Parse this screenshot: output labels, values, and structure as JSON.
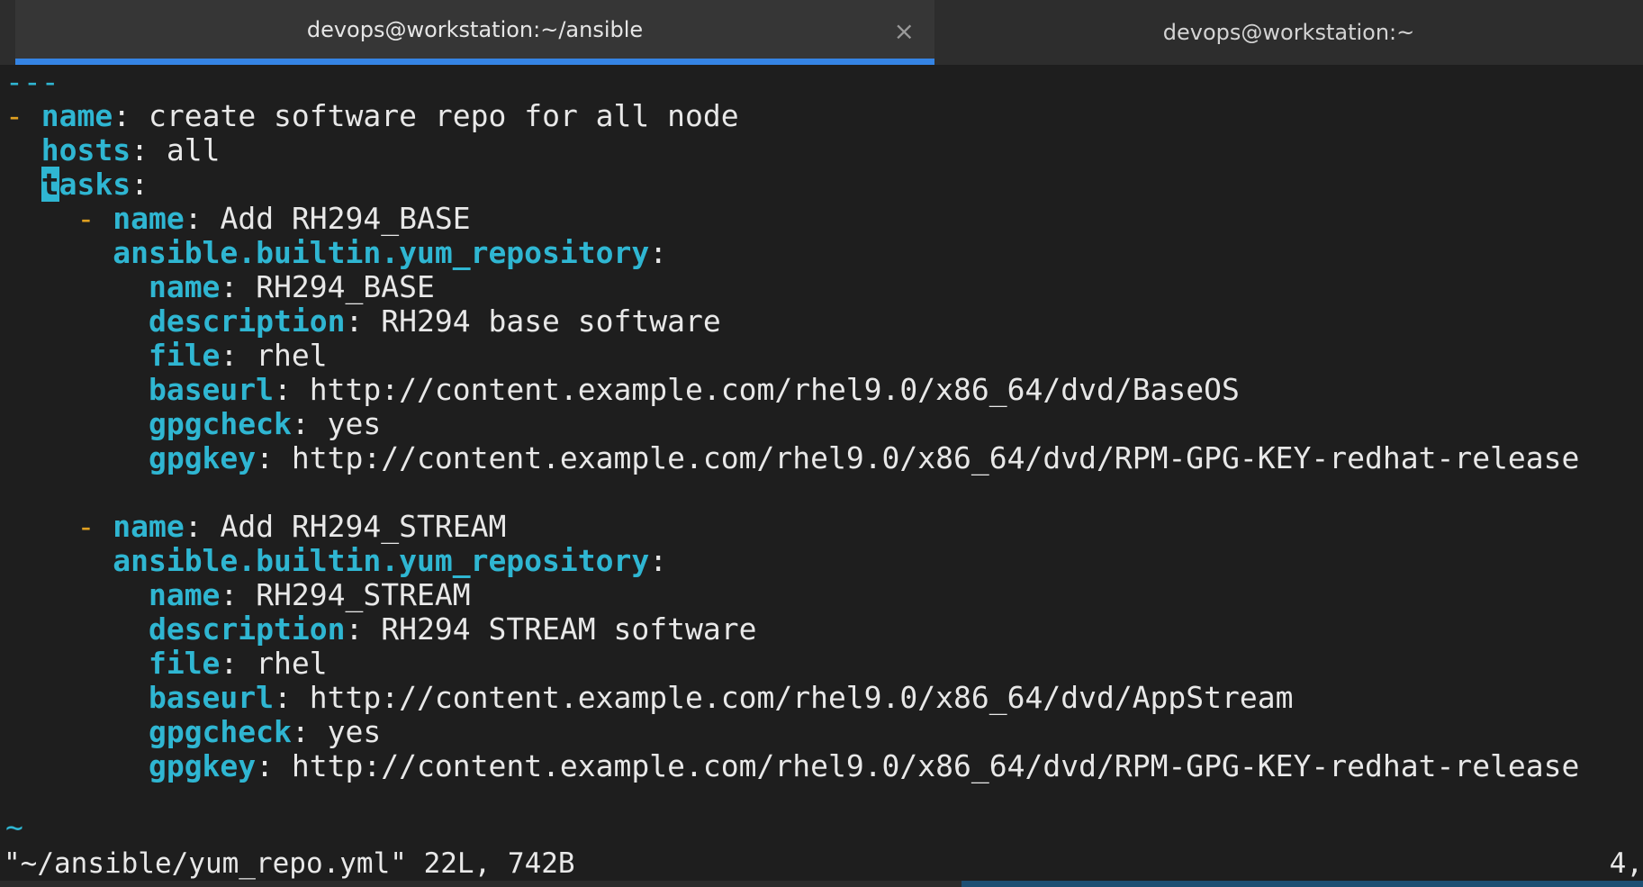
{
  "tabs": [
    {
      "label": "devops@workstation:~/ansible",
      "close_icon": "×"
    },
    {
      "label": "devops@workstation:~"
    }
  ],
  "editor": {
    "header": "---",
    "play": {
      "dash": "-",
      "name_key": "name",
      "name_value": "create software repo for all node",
      "hosts_key": "hosts",
      "hosts_value": "all",
      "tasks_cursor": "t",
      "tasks_rest": "asks"
    },
    "tasks": [
      {
        "dash": "-",
        "name_key": "name",
        "name_value": "Add RH294_BASE",
        "module": "ansible.builtin.yum_repository",
        "repo_name_key": "name",
        "repo_name_value": "RH294_BASE",
        "description_key": "description",
        "description_value": "RH294 base software",
        "file_key": "file",
        "file_value": "rhel",
        "baseurl_key": "baseurl",
        "baseurl_value": "http://content.example.com/rhel9.0/x86_64/dvd/BaseOS",
        "gpgcheck_key": "gpgcheck",
        "gpgcheck_value": "yes",
        "gpgkey_key": "gpgkey",
        "gpgkey_value": "http://content.example.com/rhel9.0/x86_64/dvd/RPM-GPG-KEY-redhat-release"
      },
      {
        "dash": "-",
        "name_key": "name",
        "name_value": "Add RH294_STREAM",
        "module": "ansible.builtin.yum_repository",
        "repo_name_key": "name",
        "repo_name_value": "RH294_STREAM",
        "description_key": "description",
        "description_value": "RH294 STREAM software",
        "file_key": "file",
        "file_value": "rhel",
        "baseurl_key": "baseurl",
        "baseurl_value": "http://content.example.com/rhel9.0/x86_64/dvd/AppStream",
        "gpgcheck_key": "gpgcheck",
        "gpgcheck_value": "yes",
        "gpgkey_key": "gpgkey",
        "gpgkey_value": "http://content.example.com/rhel9.0/x86_64/dvd/RPM-GPG-KEY-redhat-release"
      }
    ],
    "tilde": "~"
  },
  "status": {
    "file_info": "\"~/ansible/yum_repo.yml\" 22L, 742B",
    "position": "4,"
  }
}
